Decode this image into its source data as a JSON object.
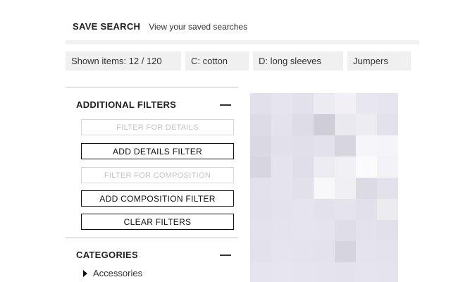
{
  "header": {
    "save_search_label": "SAVE SEARCH",
    "view_saved_label": "View your saved searches"
  },
  "chips": {
    "shown_items": "Shown items: 12 / 120",
    "composition": "C: cotton",
    "details": "D: long sleeves",
    "category": "Jumpers"
  },
  "filters": {
    "title": "ADDITIONAL FILTERS",
    "details_placeholder": "FILTER FOR DETAILS",
    "add_details_label": "ADD DETAILS FILTER",
    "composition_placeholder": "FILTER FOR COMPOSITION",
    "add_composition_label": "ADD COMPOSITION FILTER",
    "clear_label": "CLEAR FILTERS"
  },
  "categories": {
    "title": "CATEGORIES",
    "items": [
      {
        "label": "Accessories"
      }
    ]
  },
  "product_image": {
    "icons": [
      "caret-right-icon",
      "minus-icon"
    ],
    "pixel_colors": [
      [
        "#e2e0e8",
        "#e6e4ec",
        "#e3e1e9",
        "#edebf2",
        "#f2f0f6",
        "#e8e6ee",
        "#e6e4ec"
      ],
      [
        "#dddbe3",
        "#e4e2ea",
        "#dedce4",
        "#cfcdd5",
        "#ebe9f0",
        "#eeecf3",
        "#e3e1e9"
      ],
      [
        "#dad8e0",
        "#e2e0e8",
        "#e1dfe7",
        "#e3e1e9",
        "#d7d5dd",
        "#f6f5f9",
        "#f5f4f8"
      ],
      [
        "#d7d5dd",
        "#e5e3eb",
        "#e0dee6",
        "#eeecf3",
        "#f1f0f5",
        "#fbfbfd",
        "#f3f2f6"
      ],
      [
        "#e3e1e9",
        "#e5e3eb",
        "#e2e0e8",
        "#f8f7fa",
        "#f0eff4",
        "#dcdae2",
        "#e3e1e9"
      ],
      [
        "#e2e0e8",
        "#e4e2ea",
        "#e6e4ec",
        "#e3e1e9",
        "#e5e3eb",
        "#e2e0e8",
        "#ecebf0"
      ],
      [
        "#e4e2ea",
        "#e5e3eb",
        "#e6e4ec",
        "#e5e3eb",
        "#dfdde5",
        "#e4e2ea",
        "#e2e0e8"
      ],
      [
        "#e3e1e9",
        "#e6e4ec",
        "#e5e3eb",
        "#e4e2ea",
        "#d6d4dc",
        "#e5e3eb",
        "#e4e2ea"
      ],
      [
        "#e6e4ec",
        "#e7e5ed",
        "#e6e4ec",
        "#e5e3eb",
        "#e4e2ea",
        "#e6e4ec",
        "#e5e3eb"
      ]
    ]
  }
}
